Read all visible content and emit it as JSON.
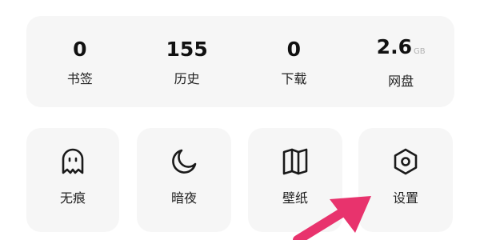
{
  "stats": [
    {
      "value": "0",
      "unit": "",
      "label": "书签"
    },
    {
      "value": "155",
      "unit": "",
      "label": "历史"
    },
    {
      "value": "0",
      "unit": "",
      "label": "下载"
    },
    {
      "value": "2.6",
      "unit": "GB",
      "label": "网盘"
    }
  ],
  "tiles": [
    {
      "label": "无痕",
      "icon": "ghost-icon"
    },
    {
      "label": "暗夜",
      "icon": "moon-icon"
    },
    {
      "label": "壁纸",
      "icon": "wallpaper-icon"
    },
    {
      "label": "设置",
      "icon": "hexagon-gear-icon"
    }
  ],
  "annotation": {
    "arrow_color": "#e8336d"
  }
}
